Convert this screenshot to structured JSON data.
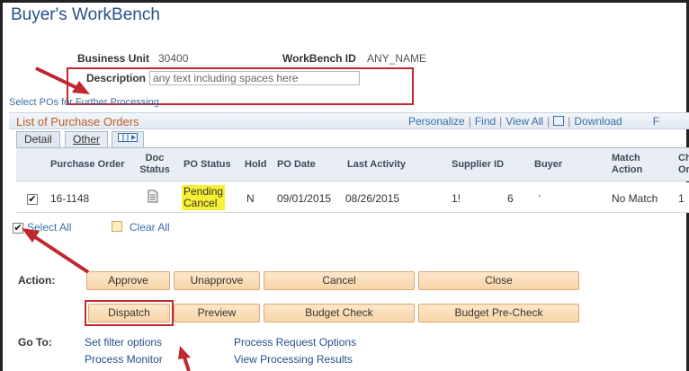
{
  "page": {
    "title": "Buyer's WorkBench"
  },
  "header": {
    "business_unit_label": "Business Unit",
    "business_unit_value": "30400",
    "workbench_id_label": "WorkBench ID",
    "workbench_id_value": "ANY_NAME",
    "description_label": "Description",
    "description_value": "any text including spaces here"
  },
  "select_prompt": "Select POs for Further Processing",
  "grid": {
    "title": "List of Purchase Orders",
    "tools": {
      "personalize": "Personalize",
      "find": "Find",
      "view_all": "View All",
      "download": "Download",
      "first": "F"
    },
    "tabs": [
      "Detail",
      "Other"
    ],
    "columns": [
      "Purchase Order",
      "Doc Status",
      "PO Status",
      "Hold",
      "PO Date",
      "Last Activity",
      "Supplier ID",
      "Buyer",
      "Match Action",
      "Ch Or"
    ],
    "rows": [
      {
        "checked": true,
        "purchase_order": "16-1148",
        "po_status": "Pending Cancel",
        "hold": "N",
        "po_date": "09/01/2015",
        "last_activity": "08/26/2015",
        "supplier_id_a": "1!",
        "supplier_id_b": "6",
        "buyer": ",",
        "match_action": "No Match",
        "change_order": "1"
      }
    ]
  },
  "select_all": "Select All",
  "clear_all": "Clear All",
  "action": {
    "label": "Action:",
    "row1": [
      "Approve",
      "Unapprove",
      "Cancel",
      "Close"
    ],
    "row2": [
      "Dispatch",
      "Preview",
      "Budget Check",
      "Budget Pre-Check"
    ]
  },
  "goto": {
    "label": "Go To:",
    "col1": [
      "Set filter options",
      "Process Monitor"
    ],
    "col2": [
      "Process Request Options",
      "View Processing Results"
    ]
  },
  "colors": {
    "accent_red": "#c0282d",
    "link_blue": "#3b6ea8",
    "button_bg": "#f8d5a8",
    "highlight_yellow": "#f8f033",
    "grid_title_orange": "#c25b27"
  }
}
